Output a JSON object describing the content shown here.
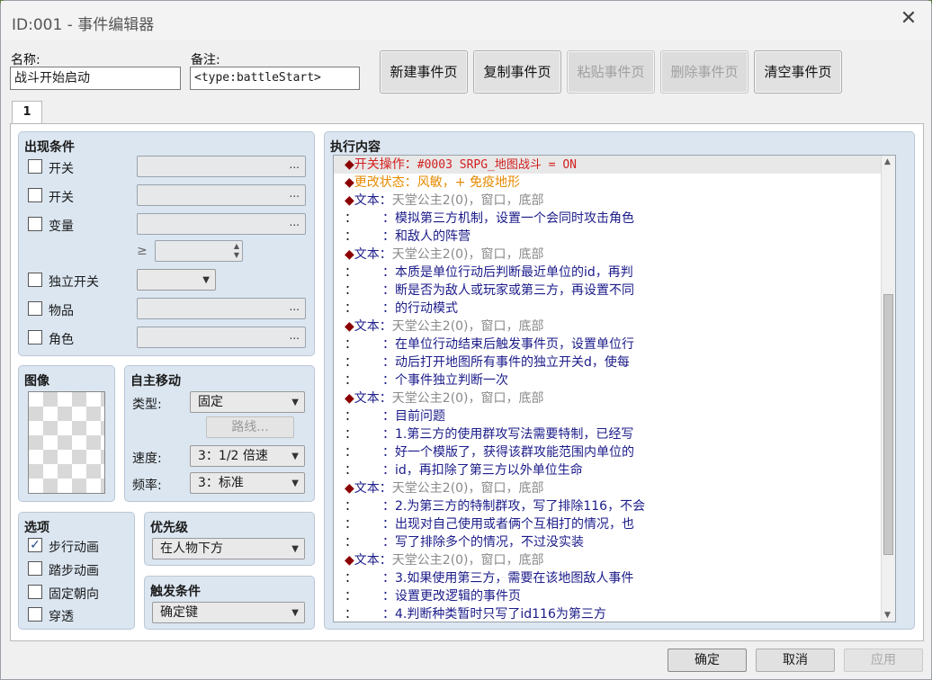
{
  "window": {
    "title": "ID:001 - 事件编辑器",
    "close_glyph": "✕"
  },
  "header": {
    "name_label": "名称:",
    "name_value": "战斗开始启动",
    "note_label": "备注:",
    "note_value": "<type:battleStart>",
    "buttons": {
      "new": "新建事件页",
      "copy": "复制事件页",
      "paste": "粘贴事件页",
      "delete": "删除事件页",
      "clear": "清空事件页"
    }
  },
  "tab": {
    "label": "1"
  },
  "conditions": {
    "title": "出现条件",
    "switch1": "开关",
    "switch2": "开关",
    "variable": "变量",
    "gte": "≥",
    "self_switch": "独立开关",
    "item": "物品",
    "actor": "角色",
    "dots": "..."
  },
  "image": {
    "title": "图像"
  },
  "autonomous": {
    "title": "自主移动",
    "type_label": "类型:",
    "type_value": "固定",
    "route_button": "路线...",
    "speed_label": "速度:",
    "speed_value": "3：1/2 倍速",
    "freq_label": "频率:",
    "freq_value": "3：标准"
  },
  "options": {
    "title": "选项",
    "walking": "步行动画",
    "walking_checked": true,
    "stepping": "踏步动画",
    "direction_fix": "固定朝向",
    "through": "穿透",
    "check_mark": "✓"
  },
  "priority": {
    "title": "优先级",
    "value": "在人物下方"
  },
  "trigger": {
    "title": "触发条件",
    "value": "确定键"
  },
  "exec": {
    "title": "执行内容",
    "lines": [
      {
        "prefix": "◆",
        "head": "开关操作：",
        "body": "#0003 SRPG_地图战斗 = ON",
        "cls": "c-red"
      },
      {
        "prefix": "◆",
        "head": "更改状态：",
        "body": "风敏，+ 免疫地形",
        "cls": "c-orange"
      },
      {
        "prefix": "◆",
        "head": "文本：",
        "body": "天堂公主2(0)，窗口，底部",
        "cls": "text"
      },
      {
        "prefix": "：",
        "head": "：",
        "body": "模拟第三方机制，设置一个会同时攻击角色",
        "cls": "cont"
      },
      {
        "prefix": "：",
        "head": "：",
        "body": "和敌人的阵营",
        "cls": "cont"
      },
      {
        "prefix": "◆",
        "head": "文本：",
        "body": "天堂公主2(0)，窗口，底部",
        "cls": "text"
      },
      {
        "prefix": "：",
        "head": "：",
        "body": "本质是单位行动后判断最近单位的id，再判",
        "cls": "cont"
      },
      {
        "prefix": "：",
        "head": "：",
        "body": "断是否为敌人或玩家或第三方，再设置不同",
        "cls": "cont"
      },
      {
        "prefix": "：",
        "head": "：",
        "body": "的行动模式",
        "cls": "cont"
      },
      {
        "prefix": "◆",
        "head": "文本：",
        "body": "天堂公主2(0)，窗口，底部",
        "cls": "text"
      },
      {
        "prefix": "：",
        "head": "：",
        "body": "在单位行动结束后触发事件页，设置单位行",
        "cls": "cont"
      },
      {
        "prefix": "：",
        "head": "：",
        "body": "动后打开地图所有事件的独立开关d，使每",
        "cls": "cont"
      },
      {
        "prefix": "：",
        "head": "：",
        "body": "个事件独立判断一次",
        "cls": "cont"
      },
      {
        "prefix": "◆",
        "head": "文本：",
        "body": "天堂公主2(0)，窗口，底部",
        "cls": "text"
      },
      {
        "prefix": "：",
        "head": "：",
        "body": "目前问题",
        "cls": "cont"
      },
      {
        "prefix": "：",
        "head": "：",
        "body": "1.第三方的使用群攻写法需要特制，已经写",
        "cls": "cont"
      },
      {
        "prefix": "：",
        "head": "：",
        "body": "好一个模版了，获得该群攻能范围内单位的",
        "cls": "cont"
      },
      {
        "prefix": "：",
        "head": "：",
        "body": "id，再扣除了第三方以外单位生命",
        "cls": "cont"
      },
      {
        "prefix": "◆",
        "head": "文本：",
        "body": "天堂公主2(0)，窗口，底部",
        "cls": "text"
      },
      {
        "prefix": "：",
        "head": "：",
        "body": "2.为第三方的特制群攻，写了排除116，不会",
        "cls": "cont"
      },
      {
        "prefix": "：",
        "head": "：",
        "body": "出现对自己使用或者俩个互相打的情况，也",
        "cls": "cont"
      },
      {
        "prefix": "：",
        "head": "：",
        "body": "写了排除多个的情况，不过没实装",
        "cls": "cont"
      },
      {
        "prefix": "◆",
        "head": "文本：",
        "body": "天堂公主2(0)，窗口，底部",
        "cls": "text"
      },
      {
        "prefix": "：",
        "head": "：",
        "body": "3.如果使用第三方，需要在该地图敌人事件",
        "cls": "cont"
      },
      {
        "prefix": "：",
        "head": "：",
        "body": "设置更改逻辑的事件页",
        "cls": "cont"
      },
      {
        "prefix": "：",
        "head": "：",
        "body": "4.判断种类暂时只写了id116为第三方",
        "cls": "cont"
      }
    ]
  },
  "footer": {
    "ok": "确定",
    "cancel": "取消",
    "apply": "应用"
  }
}
